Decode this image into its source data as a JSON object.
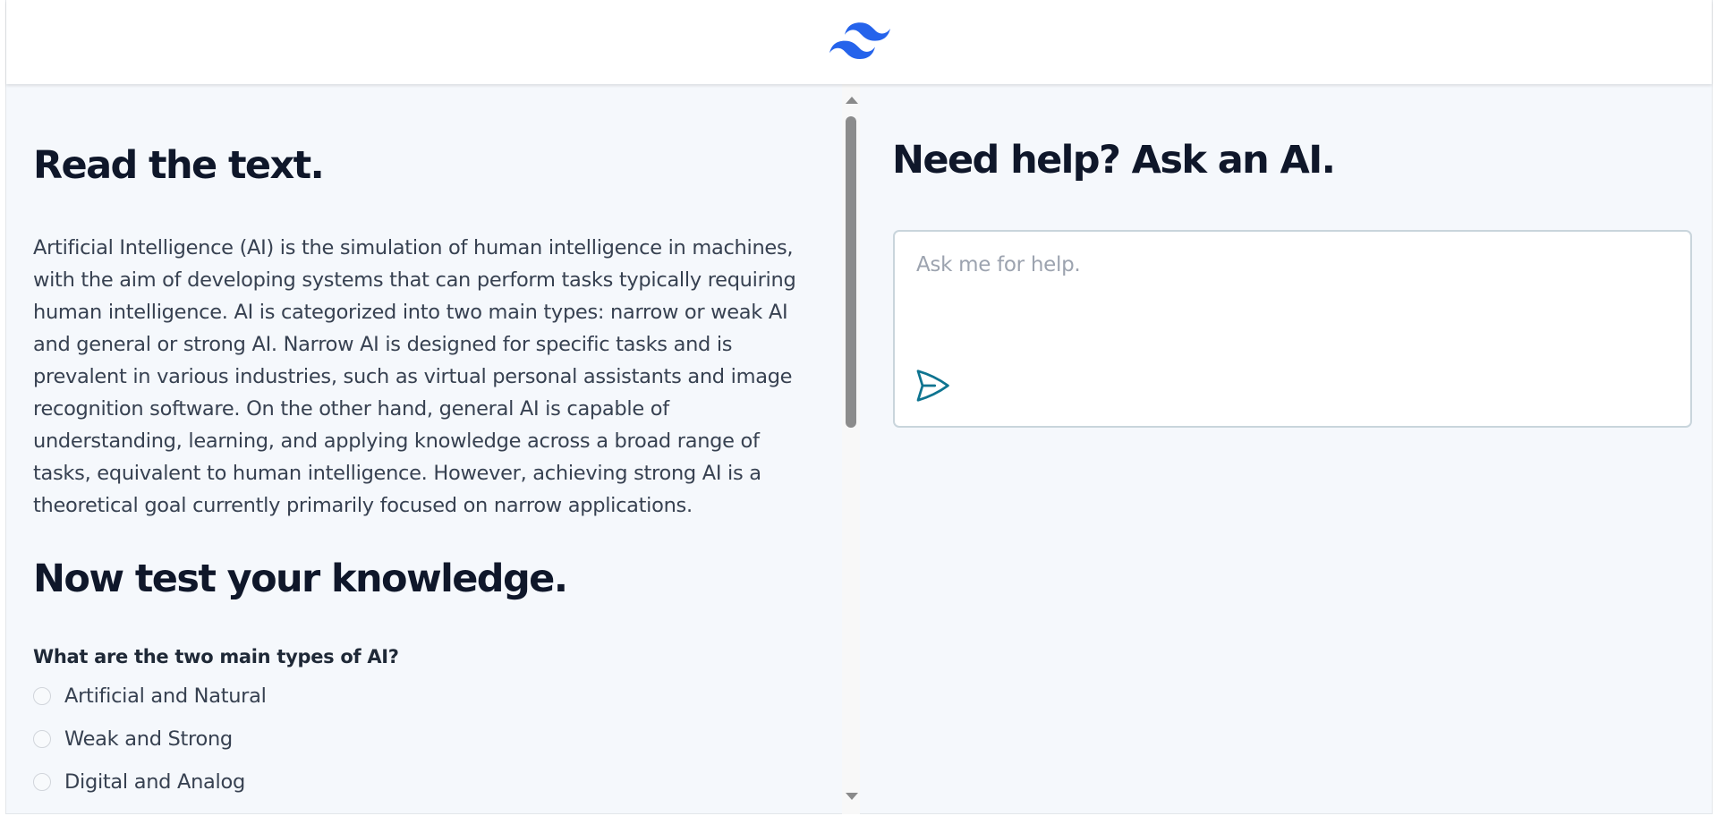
{
  "header": {
    "logo": "tailwind-logo-icon"
  },
  "reading": {
    "title": "Read the text.",
    "passage": "Artificial Intelligence (AI) is the simulation of human intelligence in machines, with the aim of developing systems that can perform tasks typically requiring human intelligence. AI is categorized into two main types: narrow or weak AI and general or strong AI. Narrow AI is designed for specific tasks and is prevalent in various industries, such as virtual personal assistants and image recognition software. On the other hand, general AI is capable of understanding, learning, and applying knowledge across a broad range of tasks, equivalent to human intelligence. However, achieving strong AI is a theoretical goal currently primarily focused on narrow applications."
  },
  "quiz": {
    "title": "Now test your knowledge.",
    "question": "What are the two main types of AI?",
    "options": [
      {
        "label": "Artificial and Natural"
      },
      {
        "label": "Weak and Strong"
      },
      {
        "label": "Digital and Analog"
      }
    ]
  },
  "assistant": {
    "title": "Need help? Ask an AI.",
    "input_value": "",
    "input_placeholder": "Ask me for help.",
    "send_icon": "send-icon"
  },
  "colors": {
    "brand": "#38bdf8",
    "logo": "#2563eb",
    "send_icon": "#0e7490",
    "page_background": "#f5f8fc",
    "heading": "#0f172a"
  }
}
